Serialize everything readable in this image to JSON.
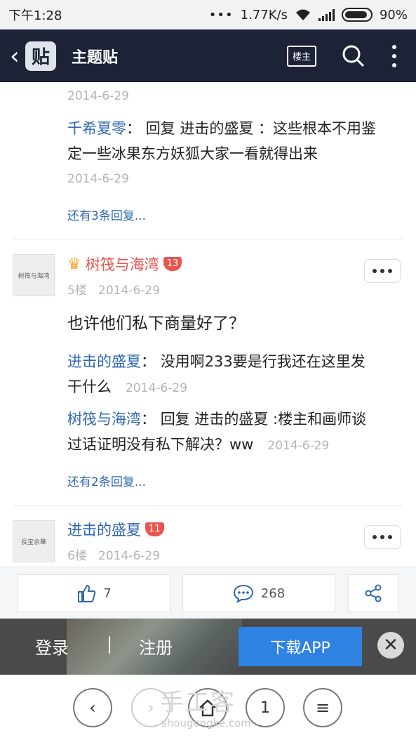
{
  "status_bar": {
    "time": "下午1:28",
    "speed": "1.77K/s",
    "battery": "90%",
    "battery_level": 0.9
  },
  "header": {
    "title": "主题贴",
    "logo_text": "贴",
    "owner_button": "楼主"
  },
  "thread": {
    "top_date": "2014-6-29",
    "reply_a": {
      "user": "千希夏零",
      "sep": "：",
      "text": "回复 进击的盛夏 ：这些根本不用鉴",
      "text2": "定一些冰果东方妖狐大家一看就得出来",
      "date": "2014-6-29"
    },
    "more_replies_1": "还有3条回复...",
    "post5": {
      "avatar_text": "树筏与海湾",
      "user": "树筏与海湾",
      "level": "13",
      "floor": "5楼",
      "date": "2014-6-29",
      "text": "也许他们私下商量好了？",
      "reply1": {
        "user": "进击的盛夏",
        "sep": "：",
        "text": "没用啊233要是行我还在这里发",
        "text2": "干什么",
        "date": "2014-6-29"
      },
      "reply2": {
        "user": "树筏与海湾",
        "sep": "：",
        "text": "回复 进击的盛夏 :楼主和画师谈",
        "text2": "过话证明没有私下解决？ww",
        "date": "2014-6-29"
      },
      "more_replies": "还有2条回复..."
    },
    "post6": {
      "avatar_text": "長宝余華",
      "user": "进击的盛夏",
      "level": "11",
      "floor": "6楼",
      "date": "2014-6-29"
    }
  },
  "actions": {
    "like_count": "7",
    "comment_count": "268"
  },
  "login_bar": {
    "login": "登录",
    "sep": "|",
    "register": "注册",
    "download": "下载APP"
  },
  "browser_bar": {
    "page": "1",
    "watermark": "手工客",
    "watermark_url": "shougongke.com"
  },
  "icons": [
    "back-icon",
    "search-icon",
    "more-icon",
    "crown-icon",
    "thumb-up-icon",
    "comment-icon",
    "share-icon",
    "close-icon",
    "prev-icon",
    "next-icon",
    "home-icon",
    "menu-icon"
  ]
}
